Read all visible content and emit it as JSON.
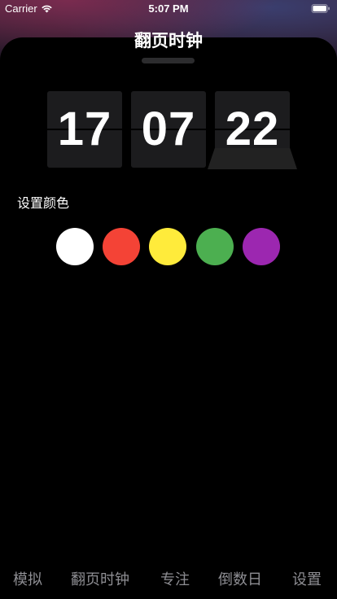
{
  "status_bar": {
    "carrier": "Carrier",
    "time": "5:07 PM",
    "wifi_icon": "wifi-icon",
    "battery_icon": "battery-icon"
  },
  "header": {
    "title": "翻页时钟"
  },
  "clock": {
    "hours": "17",
    "minutes": "07",
    "seconds": "22"
  },
  "color_setting": {
    "label": "设置颜色",
    "colors": [
      "#FFFFFF",
      "#F44336",
      "#FFEB3B",
      "#4CAF50",
      "#9C27B0"
    ]
  },
  "tab_bar": {
    "tabs": [
      {
        "label": "模拟"
      },
      {
        "label": "翻页时钟"
      },
      {
        "label": "专注"
      },
      {
        "label": "倒数日"
      },
      {
        "label": "设置"
      }
    ]
  }
}
